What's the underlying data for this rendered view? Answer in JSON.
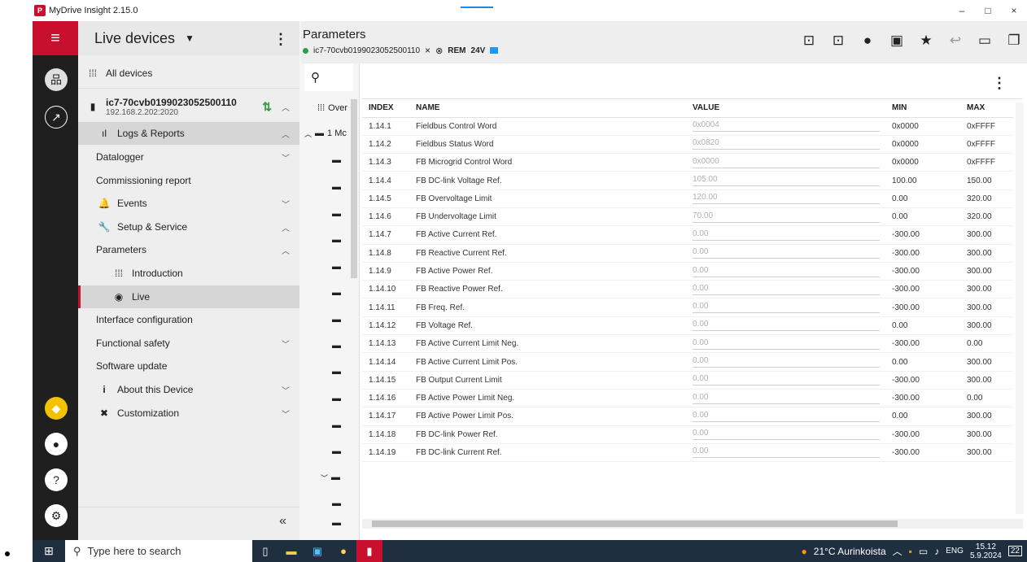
{
  "window": {
    "title": "MyDrive Insight 2.15.0",
    "logo_text": "P",
    "controls": [
      "–",
      "□",
      "×"
    ]
  },
  "nav": {
    "title": "Live devices",
    "all_devices": "All devices",
    "device_name": "ic7-70cvb0199023052500110",
    "device_ip": "192.168.2.202:2020",
    "items": [
      {
        "label": "Logs & Reports"
      },
      {
        "label": "Datalogger"
      },
      {
        "label": "Commissioning report"
      },
      {
        "label": "Events"
      },
      {
        "label": "Setup & Service"
      },
      {
        "label": "Parameters"
      },
      {
        "label": "Introduction"
      },
      {
        "label": "Live"
      },
      {
        "label": "Interface configuration"
      },
      {
        "label": "Functional safety"
      },
      {
        "label": "Software update"
      },
      {
        "label": "About this Device"
      },
      {
        "label": "Customization"
      }
    ],
    "collapse": "«"
  },
  "tree": {
    "overview": "Over",
    "first_node": "1 Mc"
  },
  "header": {
    "title": "Parameters",
    "device": "ic7-70cvb0199023052500110",
    "close": "×",
    "mode": "REM",
    "voltage": "24V"
  },
  "table": {
    "columns": [
      "INDEX",
      "NAME",
      "VALUE",
      "MIN",
      "MAX"
    ],
    "rows": [
      {
        "index": "1.14.1",
        "name": "Fieldbus Control Word",
        "value": "0x0004",
        "min": "0x0000",
        "max": "0xFFFF"
      },
      {
        "index": "1.14.2",
        "name": "Fieldbus Status Word",
        "value": "0x0820",
        "min": "0x0000",
        "max": "0xFFFF"
      },
      {
        "index": "1.14.3",
        "name": "FB Microgrid Control Word",
        "value": "0x0000",
        "min": "0x0000",
        "max": "0xFFFF"
      },
      {
        "index": "1.14.4",
        "name": "FB DC-link Voltage Ref.",
        "value": "105.00",
        "min": "100.00",
        "max": "150.00"
      },
      {
        "index": "1.14.5",
        "name": "FB Overvoltage Limit",
        "value": "120.00",
        "min": "0.00",
        "max": "320.00"
      },
      {
        "index": "1.14.6",
        "name": "FB Undervoltage Limit",
        "value": "70.00",
        "min": "0.00",
        "max": "320.00"
      },
      {
        "index": "1.14.7",
        "name": "FB Active Current Ref.",
        "value": "0.00",
        "min": "-300.00",
        "max": "300.00"
      },
      {
        "index": "1.14.8",
        "name": "FB Reactive Current Ref.",
        "value": "0.00",
        "min": "-300.00",
        "max": "300.00"
      },
      {
        "index": "1.14.9",
        "name": "FB Active Power Ref.",
        "value": "0.00",
        "min": "-300.00",
        "max": "300.00"
      },
      {
        "index": "1.14.10",
        "name": "FB Reactive Power Ref.",
        "value": "0.00",
        "min": "-300.00",
        "max": "300.00"
      },
      {
        "index": "1.14.11",
        "name": "FB Freq. Ref.",
        "value": "0.00",
        "min": "-300.00",
        "max": "300.00"
      },
      {
        "index": "1.14.12",
        "name": "FB Voltage Ref.",
        "value": "0.00",
        "min": "0.00",
        "max": "300.00"
      },
      {
        "index": "1.14.13",
        "name": "FB Active Current Limit Neg.",
        "value": "0.00",
        "min": "-300.00",
        "max": "0.00"
      },
      {
        "index": "1.14.14",
        "name": "FB Active Current Limit Pos.",
        "value": "0.00",
        "min": "0.00",
        "max": "300.00"
      },
      {
        "index": "1.14.15",
        "name": "FB Output Current Limit",
        "value": "0.00",
        "min": "-300.00",
        "max": "300.00"
      },
      {
        "index": "1.14.16",
        "name": "FB Active Power Limit Neg.",
        "value": "0.00",
        "min": "-300.00",
        "max": "0.00"
      },
      {
        "index": "1.14.17",
        "name": "FB Active Power Limit Pos.",
        "value": "0.00",
        "min": "0.00",
        "max": "300.00"
      },
      {
        "index": "1.14.18",
        "name": "FB DC-link Power Ref.",
        "value": "0.00",
        "min": "-300.00",
        "max": "300.00"
      },
      {
        "index": "1.14.19",
        "name": "FB DC-link Current Ref.",
        "value": "0.00",
        "min": "-300.00",
        "max": "300.00"
      }
    ]
  },
  "taskbar": {
    "search_placeholder": "Type here to search",
    "weather": "21°C Aurinkoista",
    "lang": "ENG",
    "time": "15.12",
    "date": "5.9.2024",
    "notif_count": "22"
  },
  "colors": {
    "brand": "#c8102e",
    "status_green": "#2e9c44",
    "flag_blue": "#2196f3"
  }
}
